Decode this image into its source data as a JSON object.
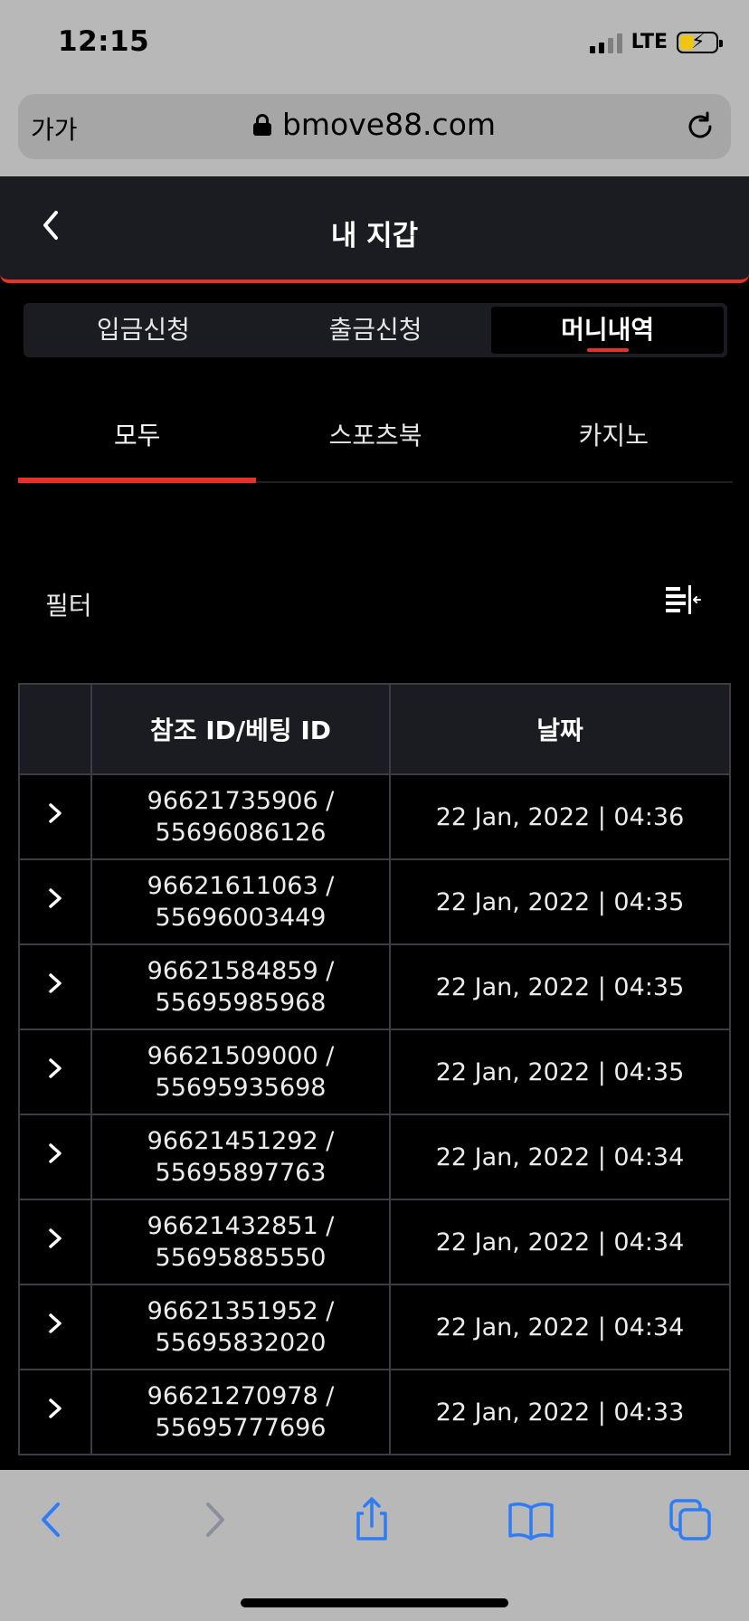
{
  "status_bar": {
    "time": "12:15",
    "network": "LTE"
  },
  "browser": {
    "text_size_label": "가가",
    "url": "bmove88.com"
  },
  "header": {
    "title": "내 지갑"
  },
  "main_tabs": [
    "입금신청",
    "출금신청",
    "머니내역"
  ],
  "main_tab_active": "머니내역",
  "sub_tabs": [
    "모두",
    "스포츠북",
    "카지노"
  ],
  "sub_tab_active": "모두",
  "filter": {
    "label": "필터"
  },
  "table": {
    "headers": [
      "",
      "참조 ID/베팅 ID",
      "날짜"
    ],
    "rows": [
      {
        "ref_id": "96621735906 /",
        "bet_id": "55696086126",
        "date": "22 Jan, 2022 | 04:36"
      },
      {
        "ref_id": "96621611063 /",
        "bet_id": "55696003449",
        "date": "22 Jan, 2022 | 04:35"
      },
      {
        "ref_id": "96621584859 /",
        "bet_id": "55695985968",
        "date": "22 Jan, 2022 | 04:35"
      },
      {
        "ref_id": "96621509000 /",
        "bet_id": "55695935698",
        "date": "22 Jan, 2022 | 04:35"
      },
      {
        "ref_id": "96621451292 /",
        "bet_id": "55695897763",
        "date": "22 Jan, 2022 | 04:34"
      },
      {
        "ref_id": "96621432851 /",
        "bet_id": "55695885550",
        "date": "22 Jan, 2022 | 04:34"
      },
      {
        "ref_id": "96621351952 /",
        "bet_id": "55695832020",
        "date": "22 Jan, 2022 | 04:34"
      },
      {
        "ref_id": "96621270978 /",
        "bet_id": "55695777696",
        "date": "22 Jan, 2022 | 04:33"
      }
    ]
  },
  "colors": {
    "accent": "#e53127",
    "header_bg": "#1b1c22",
    "page_bg": "#000000",
    "safari_blue": "#2f7cf6"
  }
}
